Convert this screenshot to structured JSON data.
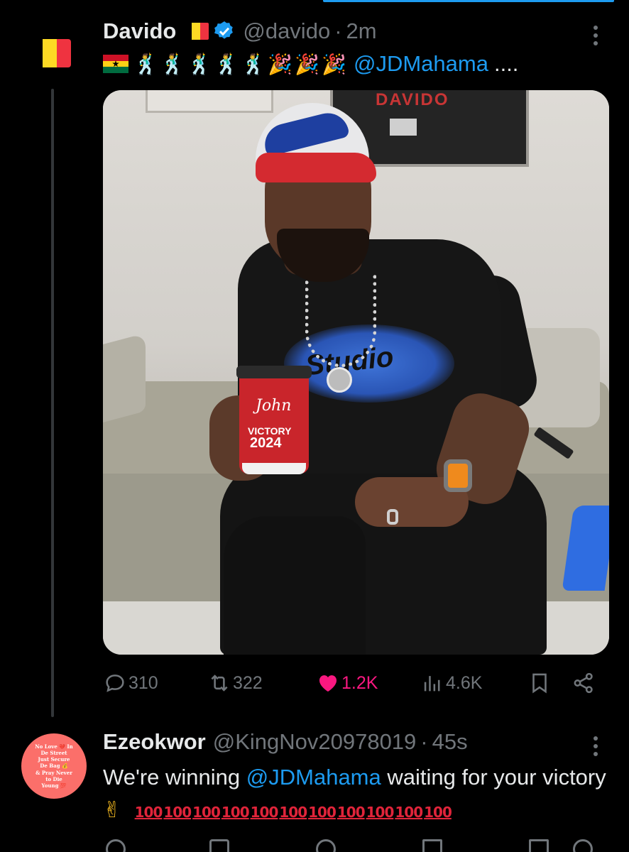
{
  "tweet": {
    "author_name": "Davido",
    "handle": "@davido",
    "separator": "·",
    "time": "2m",
    "text_mention": "@JDMahama",
    "text_suffix": "....",
    "emojis": {
      "dancer": "🕺",
      "party": "🎉"
    },
    "stats": {
      "replies": "310",
      "reposts": "322",
      "likes": "1.2K",
      "views": "4.6K"
    }
  },
  "photo": {
    "wall_logo": "DAVIDO",
    "cup_line1": "John",
    "cup_line2": "VICTORY",
    "cup_line3": "2024",
    "shirt_print": "Studio"
  },
  "reply": {
    "author_name": "Ezeokwor",
    "handle": "@KingNov20978019",
    "separator": "·",
    "time": "45s",
    "text_before": "We're winning ",
    "mention": "@JDMahama",
    "text_after": "  waiting for your victory ",
    "victory_emoji": "✌",
    "hundred": "100",
    "avatar_text": "No Love 💔 In\nDe Street\nJust Secure\nDe Bag 💰\n& Pray Never\nto Die\nYoung 💯"
  },
  "colors": {
    "accent": "#1d9bf0",
    "like": "#f91880",
    "muted": "#71767b"
  }
}
